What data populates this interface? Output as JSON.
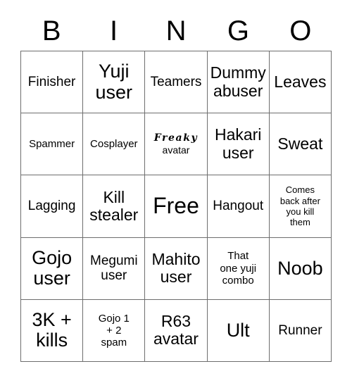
{
  "card": {
    "header_letters": [
      "B",
      "I",
      "N",
      "G",
      "O"
    ],
    "colors": {
      "background": "#ffffff",
      "text": "#000000",
      "grid_line": "#6e6e6e"
    },
    "rows": [
      [
        {
          "text": "Finisher",
          "size": "md"
        },
        {
          "text": "Yuji\nuser",
          "size": "xl"
        },
        {
          "text": "Teamers",
          "size": "md"
        },
        {
          "text": "Dummy\nabuser",
          "size": "lg"
        },
        {
          "text": "Leaves",
          "size": "lg"
        }
      ],
      [
        {
          "text": "Spammer",
          "size": "sm"
        },
        {
          "text": "Cosplayer",
          "size": "sm"
        },
        {
          "text": "Freaky\navatar",
          "size": "sm",
          "style": "freaky"
        },
        {
          "text": "Hakari\nuser",
          "size": "lg"
        },
        {
          "text": "Sweat",
          "size": "lg"
        }
      ],
      [
        {
          "text": "Lagging",
          "size": "md"
        },
        {
          "text": "Kill\nstealer",
          "size": "lg"
        },
        {
          "text": "Free",
          "size": "xxl"
        },
        {
          "text": "Hangout",
          "size": "md"
        },
        {
          "text": "Comes\nback after\nyou kill\nthem",
          "size": "xs"
        }
      ],
      [
        {
          "text": "Gojo\nuser",
          "size": "xl"
        },
        {
          "text": "Megumi\nuser",
          "size": "md"
        },
        {
          "text": "Mahito\nuser",
          "size": "lg"
        },
        {
          "text": "That\none yuji\ncombo",
          "size": "sm"
        },
        {
          "text": "Noob",
          "size": "xl"
        }
      ],
      [
        {
          "text": "3K +\nkills",
          "size": "xl"
        },
        {
          "text": "Gojo 1\n+ 2\nspam",
          "size": "sm"
        },
        {
          "text": "R63\navatar",
          "size": "lg"
        },
        {
          "text": "Ult",
          "size": "xl"
        },
        {
          "text": "Runner",
          "size": "md"
        }
      ]
    ]
  }
}
